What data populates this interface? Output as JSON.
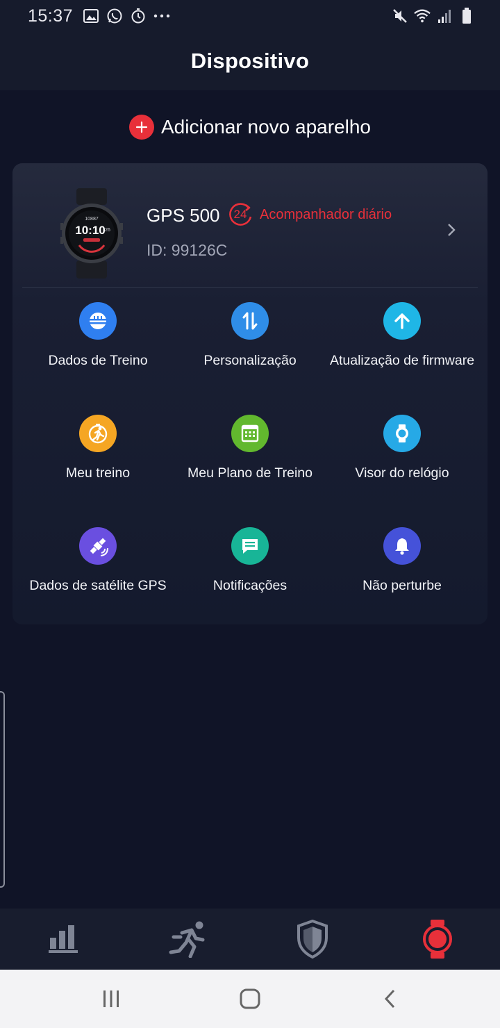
{
  "status_bar": {
    "time": "15:37",
    "left_icons": [
      "image-icon",
      "whatsapp-icon",
      "timer-icon",
      "more-icon"
    ],
    "right_icons": [
      "mute-icon",
      "wifi-icon",
      "signal-icon",
      "battery-icon"
    ]
  },
  "header": {
    "title": "Dispositivo"
  },
  "add_device": {
    "label": "Adicionar novo aparelho"
  },
  "device": {
    "name": "GPS 500",
    "tracker_badge": "24",
    "tracker_label": "Acompanhador diário",
    "id": "ID: 99126C",
    "watch_face": {
      "top": "10887",
      "time": "10:10",
      "date": "26"
    }
  },
  "features": [
    {
      "label": "Dados de Treino",
      "icon": "training-data-icon",
      "color": "#2f7ff0"
    },
    {
      "label": "Personalização",
      "icon": "customization-icon",
      "color": "#2f8de8"
    },
    {
      "label": "Atualização de firmware",
      "icon": "firmware-update-icon",
      "color": "#1fb6e6"
    },
    {
      "label": "Meu treino",
      "icon": "my-workout-icon",
      "color": "#f5a623"
    },
    {
      "label": "Meu Plano de Treino",
      "icon": "training-plan-icon",
      "color": "#62b82e"
    },
    {
      "label": "Visor do relógio",
      "icon": "watch-face-icon",
      "color": "#26a9e6"
    },
    {
      "label": "Dados de satélite GPS",
      "icon": "gps-satellite-icon",
      "color": "#6a4fe0"
    },
    {
      "label": "Notificações",
      "icon": "notifications-icon",
      "color": "#18b597"
    },
    {
      "label": "Não perturbe",
      "icon": "do-not-disturb-icon",
      "color": "#4552d9"
    }
  ],
  "bottom_nav": {
    "items": [
      "stats-icon",
      "running-icon",
      "shield-icon",
      "watch-icon"
    ],
    "active": "watch-icon",
    "active_color": "#e8303a",
    "inactive_color": "#7f8595"
  },
  "system_nav": [
    "recents-icon",
    "home-icon",
    "back-icon"
  ]
}
